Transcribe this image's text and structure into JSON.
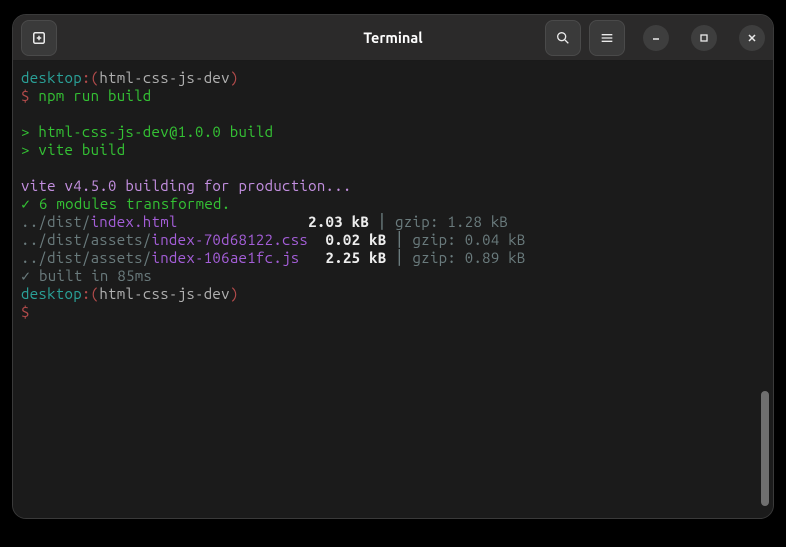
{
  "window": {
    "title": "Terminal"
  },
  "prompt": {
    "host": "desktop",
    "sep": ":",
    "branch_open": "(",
    "branch": "html-css-js-dev",
    "branch_close": ")",
    "symbol": "$"
  },
  "cmd1": "npm run build",
  "npm_out": {
    "line1_prefix": "> ",
    "line1": "html-css-js-dev@1.0.0 build",
    "line2_prefix": "> ",
    "line2": "vite build"
  },
  "vite": {
    "header_a": "vite ",
    "header_b": "v4.5.0",
    "header_c": " building for production...",
    "transformed_prefix": "✓ ",
    "transformed": "6 modules transformed.",
    "built_prefix": "✓ ",
    "built": "built in 85ms"
  },
  "rows": [
    {
      "path_a": "../dist/",
      "path_b": "",
      "file": "index.html",
      "pad": "               ",
      "size": "2.03 kB",
      "gzip": "gzip: 1.28 kB"
    },
    {
      "path_a": "../dist/",
      "path_b": "assets/",
      "file": "index-70d68122.css",
      "pad": "  ",
      "size": "0.02 kB",
      "gzip": "gzip: 0.04 kB"
    },
    {
      "path_a": "../dist/",
      "path_b": "assets/",
      "file": "index-106ae1fc.js",
      "pad": "   ",
      "size": "2.25 kB",
      "gzip": "gzip: 0.89 kB"
    }
  ],
  "pipe": " │ "
}
